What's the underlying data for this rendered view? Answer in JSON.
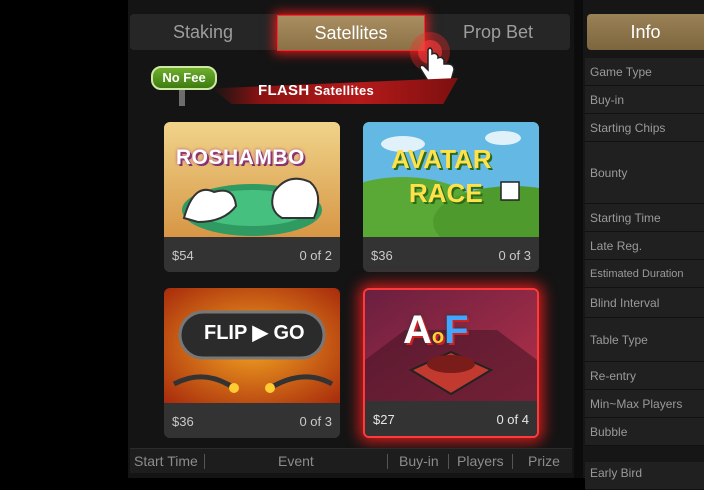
{
  "tabs": {
    "staking": "Staking",
    "satellites": "Satellites",
    "prop_bet": "Prop Bet",
    "info": "Info"
  },
  "banner": {
    "no_fee": "No Fee",
    "flash": "FLASH",
    "satellites": "Satellites"
  },
  "cards": [
    {
      "title": "ROSHAMBO",
      "price": "$54",
      "count": "0 of 2"
    },
    {
      "title_line1": "AVATAR",
      "title_line2": "RACE",
      "price": "$36",
      "count": "0 of 3"
    },
    {
      "title": "FLIP ▶ GO",
      "price": "$36",
      "count": "0 of 3"
    },
    {
      "title_a": "A",
      "title_o": "o",
      "title_f": "F",
      "price": "$27",
      "count": "0 of 4"
    }
  ],
  "columns": [
    "Start Time",
    "Event",
    "Buy-in",
    "Players",
    "Prize"
  ],
  "info_rows": [
    "Game Type",
    "Buy-in",
    "Starting Chips",
    "Bounty",
    "Starting Time",
    "Late Reg.",
    "Estimated Duration",
    "Blind Interval",
    "Table Type",
    "Re-entry",
    "Min~Max Players",
    "Bubble",
    "Early Bird"
  ],
  "colors": {
    "accent_gold": "#a98e62",
    "highlight_red": "#ff2b2b"
  }
}
